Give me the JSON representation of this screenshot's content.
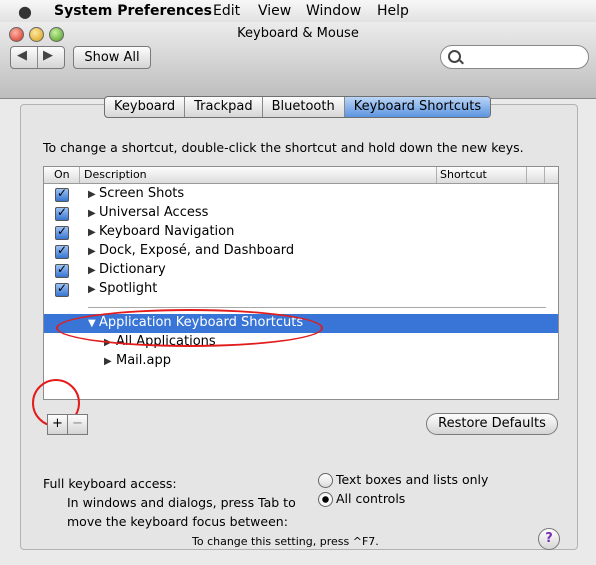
{
  "menubar": {
    "app_name": "System Preferences",
    "items": [
      "Edit",
      "View",
      "Window",
      "Help"
    ]
  },
  "window": {
    "title": "Keyboard & Mouse",
    "nav_back": "◀",
    "nav_forward": "▶",
    "show_all": "Show All",
    "search_value": ""
  },
  "tabs": [
    "Keyboard",
    "Trackpad",
    "Bluetooth",
    "Keyboard Shortcuts"
  ],
  "active_tab": "Keyboard Shortcuts",
  "instruction": "To change a shortcut, double-click the shortcut and hold down the new keys.",
  "table": {
    "headers": {
      "on": "On",
      "description": "Description",
      "shortcut": "Shortcut"
    },
    "rows": [
      {
        "label": "Screen Shots",
        "checked": true
      },
      {
        "label": "Universal Access",
        "checked": true
      },
      {
        "label": "Keyboard Navigation",
        "checked": true
      },
      {
        "label": "Dock, Exposé, and Dashboard",
        "checked": true
      },
      {
        "label": "Dictionary",
        "checked": true
      },
      {
        "label": "Spotlight",
        "checked": true
      }
    ],
    "app_group": {
      "label": "Application Keyboard Shortcuts",
      "expanded": true,
      "selected": true
    },
    "app_children": [
      {
        "label": "All Applications"
      },
      {
        "label": "Mail.app"
      }
    ]
  },
  "buttons": {
    "add": "+",
    "remove": "−",
    "restore": "Restore Defaults"
  },
  "keyboard_access": {
    "title": "Full keyboard access:",
    "desc_line1": "In windows and dialogs, press Tab to",
    "desc_line2": "move the keyboard focus between:",
    "option_text": "Text boxes and lists only",
    "option_all": "All controls",
    "selected": "All controls",
    "note": "To change this setting, press ^F7."
  },
  "help": "?",
  "annotation_color": "#e31b1b",
  "selection_color": "#3875d7"
}
